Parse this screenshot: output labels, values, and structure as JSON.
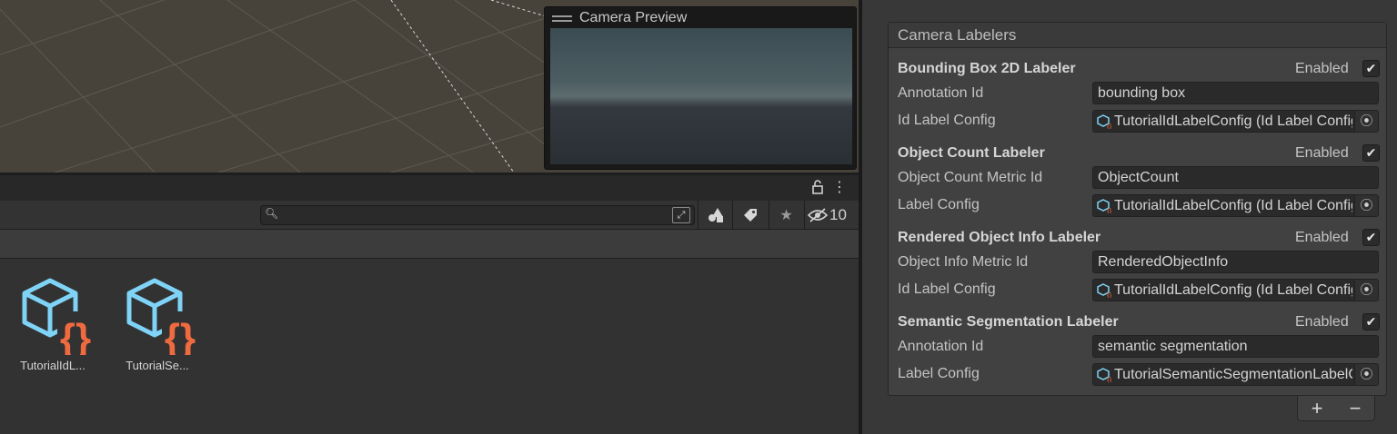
{
  "scene": {
    "camera_preview_title": "Camera Preview"
  },
  "project": {
    "search_placeholder": "",
    "hidden_count": "10",
    "assets": [
      {
        "label": "TutorialIdL..."
      },
      {
        "label": "TutorialSe..."
      }
    ]
  },
  "inspector": {
    "section_title": "Camera Labelers",
    "labelers": [
      {
        "title": "Bounding Box 2D Labeler",
        "enabled_label": "Enabled",
        "enabled": true,
        "fields": [
          {
            "label": "Annotation Id",
            "value": "bounding box",
            "kind": "text"
          },
          {
            "label": "Id Label Config",
            "value": "TutorialIdLabelConfig (Id Label Config)",
            "kind": "object"
          }
        ]
      },
      {
        "title": "Object Count Labeler",
        "enabled_label": "Enabled",
        "enabled": true,
        "fields": [
          {
            "label": "Object Count Metric Id",
            "value": "ObjectCount",
            "kind": "text"
          },
          {
            "label": "Label Config",
            "value": "TutorialIdLabelConfig (Id Label Config)",
            "kind": "object"
          }
        ]
      },
      {
        "title": "Rendered Object Info Labeler",
        "enabled_label": "Enabled",
        "enabled": true,
        "fields": [
          {
            "label": "Object Info Metric Id",
            "value": "RenderedObjectInfo",
            "kind": "text"
          },
          {
            "label": "Id Label Config",
            "value": "TutorialIdLabelConfig (Id Label Config)",
            "kind": "object"
          }
        ]
      },
      {
        "title": "Semantic Segmentation Labeler",
        "enabled_label": "Enabled",
        "enabled": true,
        "fields": [
          {
            "label": "Annotation Id",
            "value": "semantic segmentation",
            "kind": "text"
          },
          {
            "label": "Label Config",
            "value": "TutorialSemanticSegmentationLabelConfig",
            "kind": "object"
          }
        ]
      }
    ],
    "add_label": "+",
    "remove_label": "−"
  },
  "icons": {
    "lock": "lock-icon",
    "menu": "kebab-menu-icon",
    "search": "search-icon",
    "expand": "expand-icon",
    "filter_type": "filter-by-type-icon",
    "filter_label": "filter-by-label-icon",
    "favorite": "star-icon",
    "hidden": "eye-slash-icon",
    "check": "checkmark-icon",
    "object_picker": "object-picker-icon"
  },
  "colors": {
    "asset_cube": "#7fd3f7",
    "asset_braces": "#f06a3f"
  }
}
